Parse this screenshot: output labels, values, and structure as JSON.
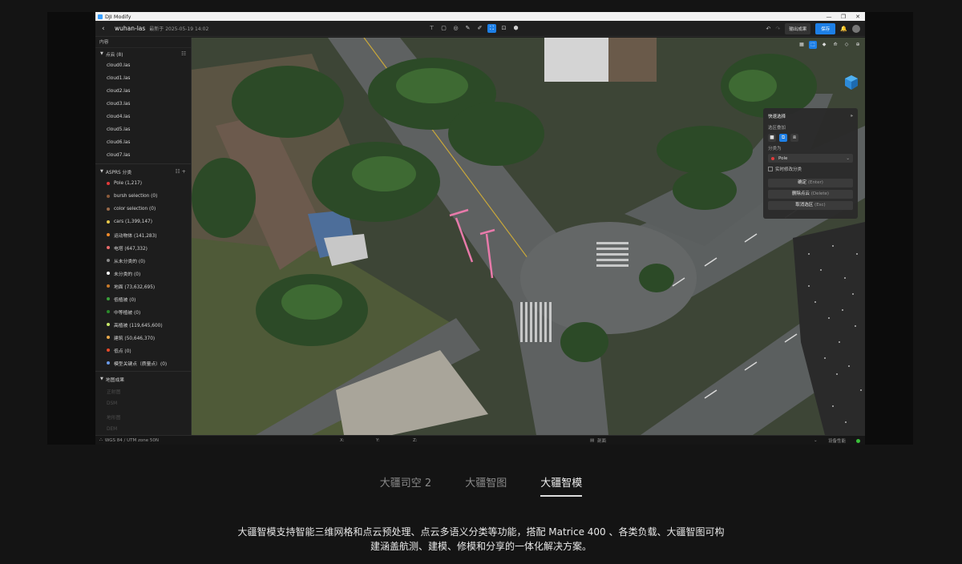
{
  "window": {
    "title": "DJI Modify",
    "controls": [
      "—",
      "❐",
      "✕"
    ]
  },
  "appbar": {
    "back_icon": "‹",
    "file_name": "wuhan-las",
    "modified": "最新于 2025-05-19 14:02",
    "tools": [
      "⊤",
      "▢",
      "◎",
      "✎",
      "✐",
      "⛶",
      "⊡",
      "⬢"
    ],
    "active_tool_index": 5,
    "undo": "↶",
    "redo": "↷",
    "export_label": "输出成果",
    "save_label": "保存",
    "bell": "🔔"
  },
  "sidebar": {
    "header": "内容",
    "cloud_section": {
      "label": "点云 (8)",
      "action": "☷"
    },
    "clouds": [
      "cloud0.las",
      "cloud1.las",
      "cloud2.las",
      "cloud3.las",
      "cloud4.las",
      "cloud5.las",
      "cloud6.las",
      "cloud7.las"
    ],
    "class_section": {
      "label": "ASPRS 分类",
      "action1": "☷",
      "action2": "+"
    },
    "classes": [
      {
        "label": "Pole (1,217)",
        "color": "#e23a3a"
      },
      {
        "label": "bursh selection (0)",
        "color": "#8a5a3a"
      },
      {
        "label": "color selection (0)",
        "color": "#9a6a4a"
      },
      {
        "label": "cars (1,399,147)",
        "color": "#e8c84a"
      },
      {
        "label": "运动物体 (141,283)",
        "color": "#f08a2a"
      },
      {
        "label": "电塔 (647,332)",
        "color": "#e86a6a"
      },
      {
        "label": "从未分类的 (0)",
        "color": "#8a8a8a"
      },
      {
        "label": "未分类的 (0)",
        "color": "#ffffff"
      },
      {
        "label": "地面 (73,632,695)",
        "color": "#c87a2a"
      },
      {
        "label": "低植被 (0)",
        "color": "#3aa03a"
      },
      {
        "label": "中等植被 (0)",
        "color": "#2a8a2a"
      },
      {
        "label": "高植被 (119,645,600)",
        "color": "#c8e86a"
      },
      {
        "label": "建筑 (50,646,370)",
        "color": "#e8a84a"
      },
      {
        "label": "低点 (0)",
        "color": "#e84a2a"
      },
      {
        "label": "模型关键点（质量点）(0)",
        "color": "#6a9ae8"
      }
    ],
    "results_section": {
      "label": "地图成果"
    },
    "results": [
      "正射图",
      "DSM",
      "地形图",
      "DEM"
    ]
  },
  "viewport": {
    "view_tools": [
      "▦",
      "⬚",
      "◆",
      "⟰",
      "◇",
      "⊕"
    ],
    "active_view_tool_index": 1
  },
  "panel": {
    "title": "快速选择",
    "expand": "»",
    "select_mode_label": "选区叠加",
    "modes": [
      "■",
      "⧉",
      "⧈"
    ],
    "active_mode_index": 1,
    "classify_label": "分类为",
    "class_value": "Pole",
    "class_color": "#e23a3a",
    "realtime_label": "实时修改分类",
    "confirm_label": "确定",
    "confirm_key": "(Enter)",
    "delete_label": "删除点云",
    "delete_key": "(Delete)",
    "cancel_label": "取消选区",
    "cancel_key": "(Esc)"
  },
  "statusbar": {
    "crs": "WGS 84 / UTM zone 50N",
    "x_label": "X:",
    "y_label": "Y:",
    "z_label": "Z:",
    "measure_label": "剖面",
    "device_label": "设备性能"
  },
  "tabs": [
    "大疆司空 2",
    "大疆智图",
    "大疆智模"
  ],
  "active_tab_index": 2,
  "description_line1": "大疆智模支持智能三维网格和点云预处理、点云多语义分类等功能，搭配 Matrice 400 、各类负载、大疆智图可构",
  "description_line2": "建涵盖航测、建模、修模和分享的一体化解决方案。"
}
